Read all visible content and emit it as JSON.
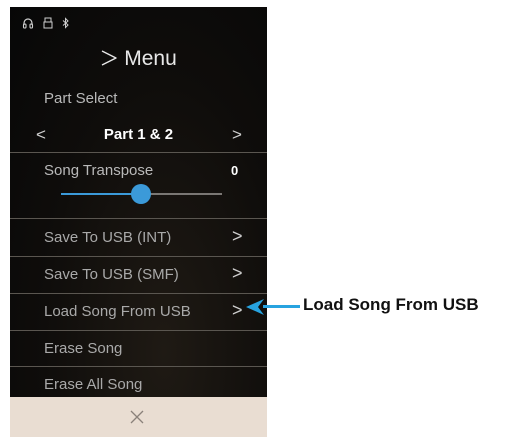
{
  "header": {
    "title": "Menu"
  },
  "status_icons": [
    "headphones-icon",
    "usb-icon",
    "bluetooth-icon"
  ],
  "part_select": {
    "label": "Part Select",
    "value": "Part 1 & 2"
  },
  "song_transpose": {
    "label": "Song Transpose",
    "value": "0",
    "slider_level": 0.5
  },
  "items": [
    {
      "label": "Save To USB (INT)",
      "has_arrow": true
    },
    {
      "label": "Save To USB (SMF)",
      "has_arrow": true
    },
    {
      "label": "Load Song From USB",
      "has_arrow": true
    },
    {
      "label": "Erase Song",
      "has_arrow": false
    },
    {
      "label": "Erase All Song",
      "has_arrow": false
    }
  ],
  "footer": {
    "close_icon": "close-icon"
  },
  "callout": {
    "text": "Load Song From USB"
  },
  "colors": {
    "accent": "#3b9ad9",
    "callout": "#27a3e0",
    "footer": "#e9ddd2"
  }
}
